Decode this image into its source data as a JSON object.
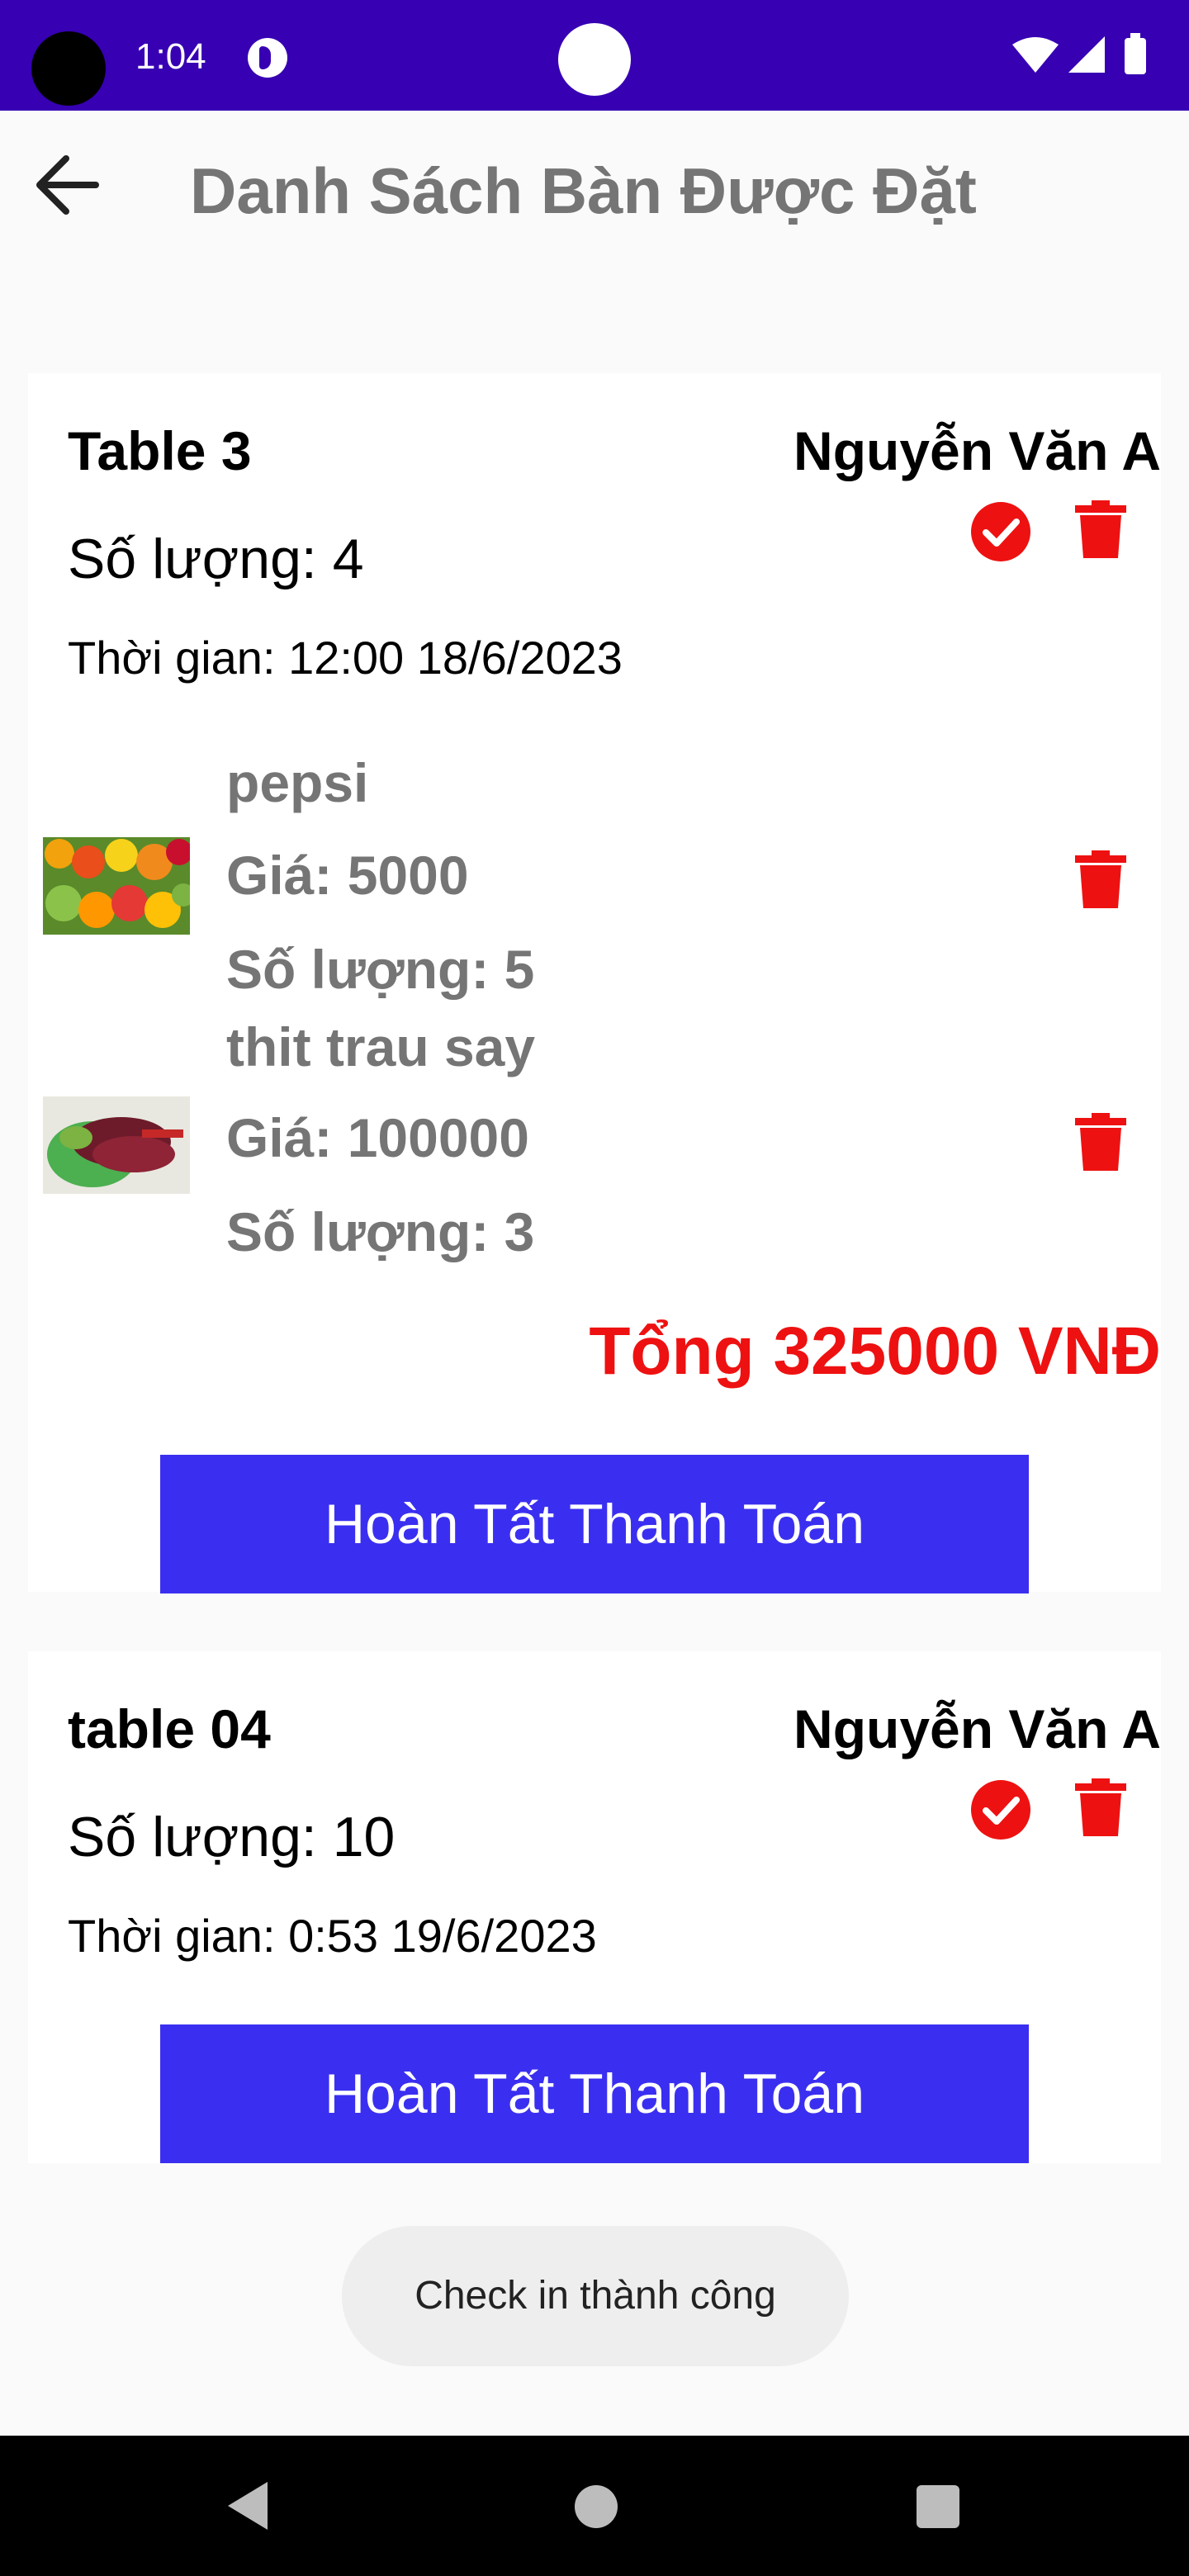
{
  "status_bar": {
    "time": "1:04"
  },
  "app_bar": {
    "title": "Danh Sách Bàn Được Đặt"
  },
  "reservations": [
    {
      "table": "Table 3",
      "customer": "Nguyễn Văn A",
      "quantity": "Số lượng: 4",
      "time": "Thời gian: 12:00 18/6/2023",
      "items": [
        {
          "name": "pepsi",
          "price": "Giá: 5000",
          "quantity": "Số lượng: 5"
        },
        {
          "name": "thit trau say",
          "price": "Giá: 100000",
          "quantity": "Số lượng: 3"
        }
      ],
      "total": "Tổng 325000 VNĐ",
      "pay_button": "Hoàn Tất Thanh Toán"
    },
    {
      "table": "table 04",
      "customer": "Nguyễn Văn A",
      "quantity": "Số lượng: 10",
      "time": "Thời gian: 0:53 19/6/2023",
      "pay_button": "Hoàn Tất Thanh Toán"
    }
  ],
  "toast": "Check in thành công",
  "colors": {
    "status_bar": "#3700b3",
    "accent_button": "#3a2ff0",
    "total_red": "#ee1111",
    "icon_red": "#ee1111"
  },
  "icons": [
    "back-arrow-icon",
    "check-circle-icon",
    "trash-icon",
    "wifi-icon",
    "signal-icon",
    "battery-icon"
  ]
}
